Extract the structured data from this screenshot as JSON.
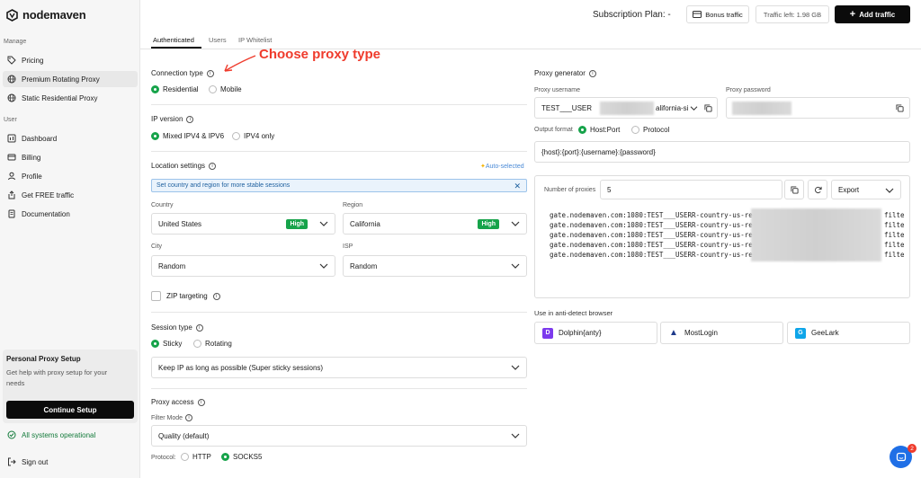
{
  "brand": {
    "name": "nodemaven"
  },
  "sidebar": {
    "manage_label": "Manage",
    "manage_items": [
      {
        "label": "Pricing",
        "icon": "tag-icon"
      },
      {
        "label": "Premium Rotating Proxy",
        "icon": "globe-icon",
        "active": true
      },
      {
        "label": "Static Residential Proxy",
        "icon": "globe-icon"
      }
    ],
    "user_label": "User",
    "user_items": [
      {
        "label": "Dashboard",
        "icon": "chart-icon"
      },
      {
        "label": "Billing",
        "icon": "card-icon"
      },
      {
        "label": "Profile",
        "icon": "person-icon"
      },
      {
        "label": "Get FREE traffic",
        "icon": "share-icon"
      },
      {
        "label": "Documentation",
        "icon": "doc-icon"
      }
    ],
    "setup": {
      "title": "Personal Proxy Setup",
      "description": "Get help with proxy setup for your needs",
      "button": "Continue Setup"
    },
    "status": "All systems operational",
    "signout": "Sign out"
  },
  "header": {
    "plan": "Subscription Plan: -",
    "bonus": "Bonus traffic",
    "traffic_left": "Traffic left: 1.98 GB",
    "add_traffic": "Add traffic"
  },
  "tabs": [
    "Authenticated",
    "Users",
    "IP Whitelist"
  ],
  "annotation": "Choose proxy type",
  "form": {
    "connection_type": {
      "label": "Connection type",
      "options": [
        "Residential",
        "Mobile"
      ],
      "selected": "Residential"
    },
    "ip_version": {
      "label": "IP version",
      "options": [
        "Mixed IPV4 & IPV6",
        "IPV4 only"
      ],
      "selected": "Mixed IPV4 & IPV6"
    },
    "location": {
      "label": "Location settings",
      "auto_selected": "Auto-selected",
      "note": "Set country and region for more stable sessions",
      "country_label": "Country",
      "country_value": "United States",
      "country_badge": "High",
      "region_label": "Region",
      "region_value": "California",
      "region_badge": "High",
      "city_label": "City",
      "city_value": "Random",
      "isp_label": "ISP",
      "isp_value": "Random",
      "zip_label": "ZIP targeting"
    },
    "session": {
      "label": "Session type",
      "options": [
        "Sticky",
        "Rotating"
      ],
      "selected": "Sticky",
      "value": "Keep IP as long as possible (Super sticky sessions)"
    },
    "access": {
      "label": "Proxy access",
      "filter_label": "Filter Mode",
      "filter_value": "Quality (default)",
      "protocol_label": "Protocol:",
      "protocols": [
        "HTTP",
        "SOCKS5"
      ],
      "protocol_selected": "SOCKS5"
    }
  },
  "generator": {
    "label": "Proxy generator",
    "username_label": "Proxy username",
    "username_prefix": "TEST___USER",
    "username_suffix": "alifornia-si",
    "password_label": "Proxy password",
    "output_label": "Output format",
    "output_options": [
      "Host:Port",
      "Protocol"
    ],
    "output_selected": "Host:Port",
    "format": "{host}:{port}:{username}:{password}",
    "num_label": "Number of proxies",
    "num_value": "5",
    "export": "Export",
    "proxies": [
      {
        "prefix": "gate.nodemaven.com:1080:TEST___USERR-country-us-reg",
        "suffix": "filte"
      },
      {
        "prefix": "gate.nodemaven.com:1080:TEST___USERR-country-us-reg",
        "suffix": "filte"
      },
      {
        "prefix": "gate.nodemaven.com:1080:TEST___USERR-country-us-reg",
        "suffix": "filte"
      },
      {
        "prefix": "gate.nodemaven.com:1080:TEST___USERR-country-us-reg",
        "suffix": "filte"
      },
      {
        "prefix": "gate.nodemaven.com:1080:TEST___USERR-country-us-reg",
        "suffix": "filte"
      }
    ],
    "browser_label": "Use in anti-detect browser",
    "browsers": [
      {
        "name": "Dolphin{anty}",
        "color": "#7c3aed"
      },
      {
        "name": "MostLogin",
        "color": "#1e3a8a"
      },
      {
        "name": "GeeLark",
        "color": "#0ea5e9"
      }
    ]
  },
  "chat": {
    "badge": "2"
  },
  "colors": {
    "accent": "#16a34a",
    "annotation": "#ef3b2c",
    "primary_button": "#0b0b0b",
    "chat": "#1f6fe6"
  }
}
